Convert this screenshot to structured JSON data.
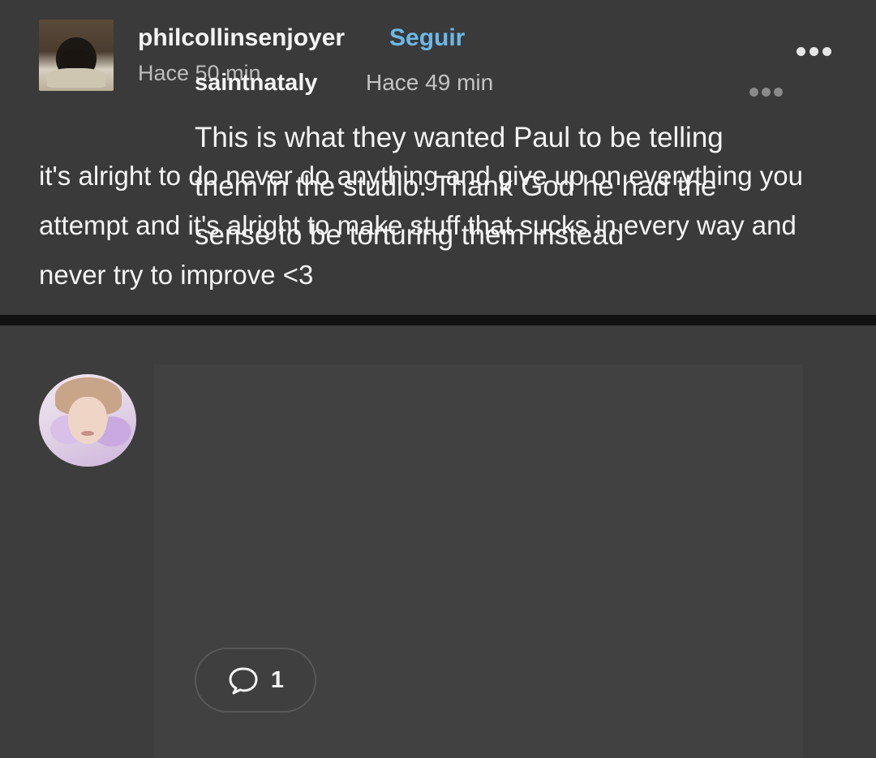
{
  "post": {
    "username": "philcollinsenjoyer",
    "follow_label": "Seguir",
    "timestamp": "Hace 50 min",
    "text": "it's alright to do never do anything and give up on everything you attempt and it's alright to make stuff that sucks in every way and never try to improve <3",
    "more_icon": "more-horizontal-icon"
  },
  "reply": {
    "username": "saintnataly",
    "timestamp": "Hace 49 min",
    "text": "This is what they wanted Paul to be telling them in the studio. Thank God he had the sense to be torturing them instead",
    "more_icon": "more-horizontal-icon",
    "reply_icon": "speech-bubble-icon",
    "reply_count": "1"
  },
  "colors": {
    "follow": "#6cb8e8",
    "background": "#3a3a3a",
    "divider": "#121212"
  }
}
